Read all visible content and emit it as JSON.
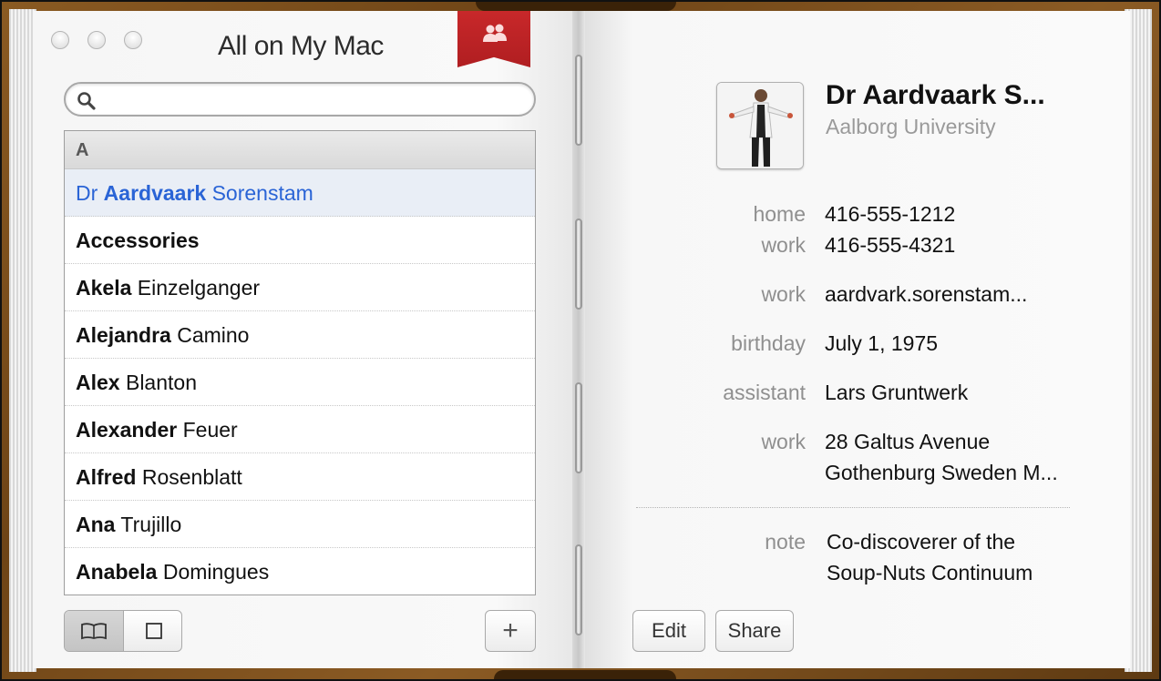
{
  "window": {
    "title": "All on My Mac"
  },
  "search": {
    "placeholder": "",
    "value": ""
  },
  "list": {
    "section": "A",
    "rows": [
      {
        "first": "Dr ",
        "bold": "Aardvaark",
        "last": " Sorenstam",
        "selected": true
      },
      {
        "first": "",
        "bold": "Accessories",
        "last": ""
      },
      {
        "first": "",
        "bold": "Akela",
        "last": " Einzelganger"
      },
      {
        "first": "",
        "bold": "Alejandra",
        "last": " Camino"
      },
      {
        "first": "",
        "bold": "Alex",
        "last": " Blanton"
      },
      {
        "first": "",
        "bold": "Alexander",
        "last": " Feuer"
      },
      {
        "first": "",
        "bold": "Alfred",
        "last": " Rosenblatt"
      },
      {
        "first": "",
        "bold": "Ana",
        "last": " Trujillo"
      },
      {
        "first": "",
        "bold": "Anabela",
        "last": " Domingues"
      }
    ]
  },
  "bottom_left": {
    "add_label": "+"
  },
  "contact": {
    "name": "Dr Aardvaark S...",
    "company": "Aalborg University",
    "fields": {
      "home_label": "home",
      "home_value": "416-555-1212",
      "work_phone_label": "work",
      "work_phone_value": "416-555-4321",
      "work_email_label": "work",
      "work_email_value": "aardvark.sorenstam...",
      "birthday_label": "birthday",
      "birthday_value": "July 1, 1975",
      "assistant_label": "assistant",
      "assistant_value": "Lars Gruntwerk",
      "address_label": "work",
      "address_line1": "28 Galtus Avenue",
      "address_line2": "Gothenburg Sweden M...",
      "note_label": "note",
      "note_line1": "Co-discoverer of the",
      "note_line2": "Soup-Nuts Continuum"
    }
  },
  "buttons": {
    "edit": "Edit",
    "share": "Share"
  },
  "colors": {
    "selected_text": "#2a64d6",
    "ribbon": "#c8282a",
    "frame": "#8a5a22"
  }
}
